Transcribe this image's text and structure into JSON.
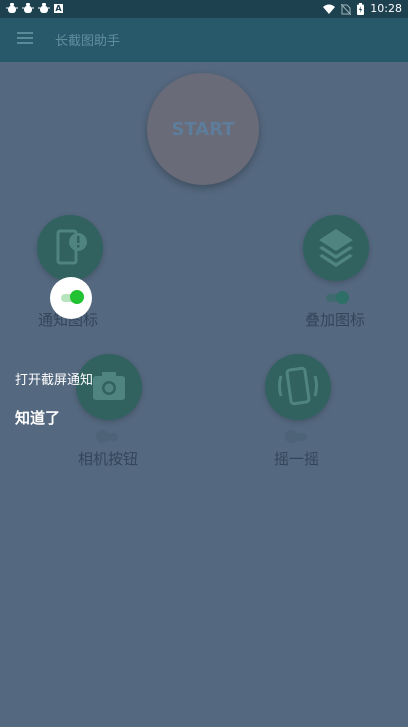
{
  "status_bar": {
    "left_icons": [
      "bug-icon",
      "bug-icon",
      "bug-icon",
      "a-icon"
    ],
    "a_label": "A",
    "right_icons": [
      "wifi-icon",
      "no-sim-icon",
      "battery-icon"
    ],
    "time": "10:28"
  },
  "app_bar": {
    "title": "长截图助手",
    "menu_icon": "hamburger-menu-icon"
  },
  "start_button": {
    "label": "START"
  },
  "features": [
    {
      "label": "通知图标",
      "icon": "notification-alert-icon",
      "enabled": true
    },
    {
      "label": "叠加图标",
      "icon": "layers-icon",
      "enabled": true
    },
    {
      "label": "相机按钮",
      "icon": "camera-icon",
      "enabled": false
    },
    {
      "label": "摇一摇",
      "icon": "shake-phone-icon",
      "enabled": false
    }
  ],
  "tip": {
    "text": "打开截屏通知",
    "button": "知道了"
  },
  "colors": {
    "overlay_bg": "#54687f",
    "app_bar": "#28596b",
    "status_bar": "#1e4150",
    "feature_circle": "#316260",
    "toggle_on": "#23c232",
    "toggle_on_dim": "#2e6f67"
  }
}
